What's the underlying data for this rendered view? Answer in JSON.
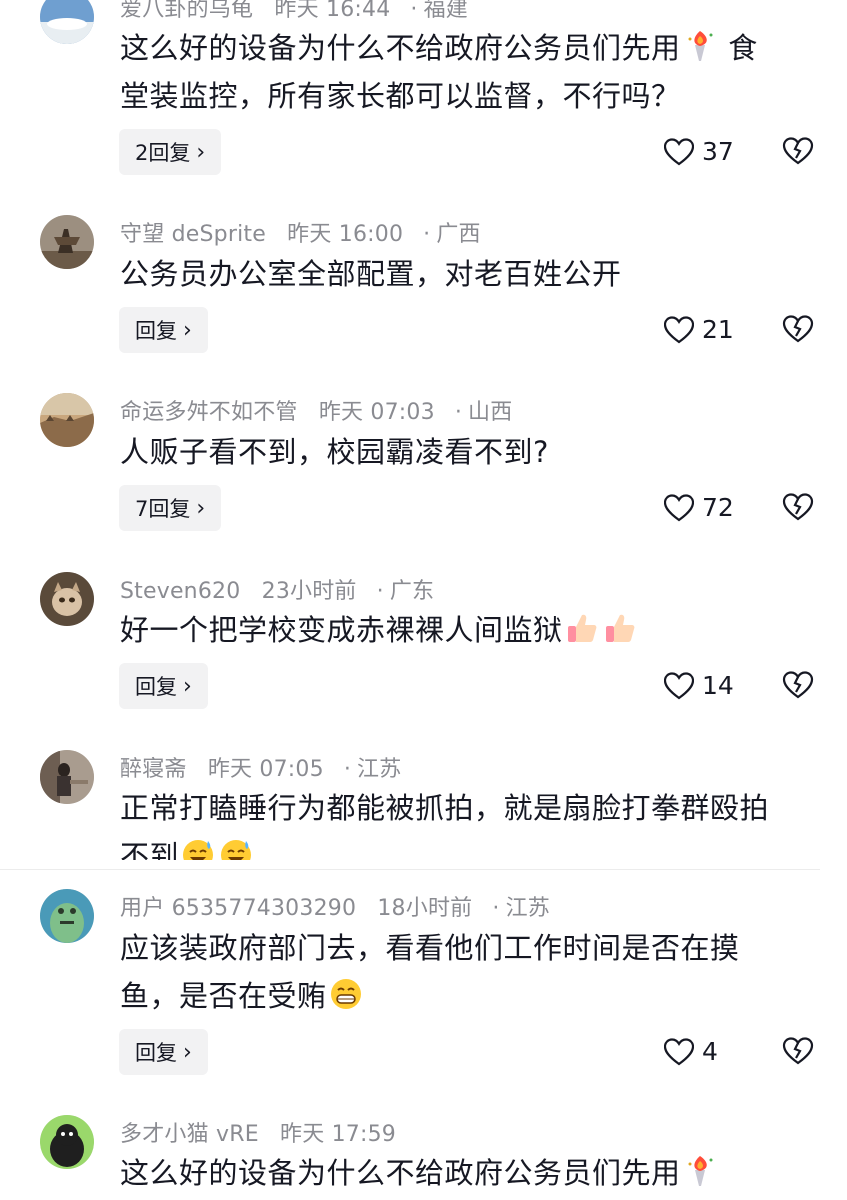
{
  "comments": [
    {
      "user": "爱八卦的乌龟",
      "time": "昨天 16:44",
      "location": "福建",
      "line1": "这么好的设备为什么不给政府公务员们先用",
      "line2": "堂装监控，所有家长都可以监督，不行吗？",
      "after_emoji": "食",
      "reply_label": "2回复",
      "likes": "37"
    },
    {
      "user": "守望 deSprite",
      "time": "昨天 16:00",
      "location": "广西",
      "line1": "公务员办公室全部配置，对老百姓公开",
      "reply_label": "回复",
      "likes": "21"
    },
    {
      "user": "命运多舛不如不管",
      "time": "昨天 07:03",
      "location": "山西",
      "line1": "人贩子看不到，校园霸凌看不到?",
      "reply_label": "7回复",
      "likes": "72"
    },
    {
      "user": "Steven620",
      "time": "23小时前",
      "location": "广东",
      "line1": "好一个把学校变成赤裸裸人间监狱",
      "reply_label": "回复",
      "likes": "14"
    },
    {
      "user": "醉寝斋",
      "time": "昨天 07:05",
      "location": "江苏",
      "line1": "正常打瞌睡行为都能被抓拍，就是扇脸打拳群殴拍",
      "line2": "不到"
    },
    {
      "user": "用户 6535774303290",
      "time": "18小时前",
      "location": "江苏",
      "line1": "应该装政府部门去，看看他们工作时间是否在摸",
      "line2": "鱼，是否在受贿",
      "reply_label": "回复",
      "likes": "4"
    },
    {
      "user": "多才小猫 vRE",
      "time": "昨天 17:59",
      "line1": "这么好的设备为什么不给政府公务员们先用"
    }
  ],
  "icons": {
    "like": "heart-outline-icon",
    "dislike": "broken-heart-icon",
    "reply_chevron": "chevron-right-icon",
    "torch": "torch-emoji",
    "thumbs": "thumbs-up-emoji",
    "sweat": "sweat-smile-emoji",
    "grin": "grin-emoji"
  },
  "colors": {
    "text": "#161823",
    "meta": "#8a8b91",
    "reply_bg": "#f2f2f3"
  }
}
